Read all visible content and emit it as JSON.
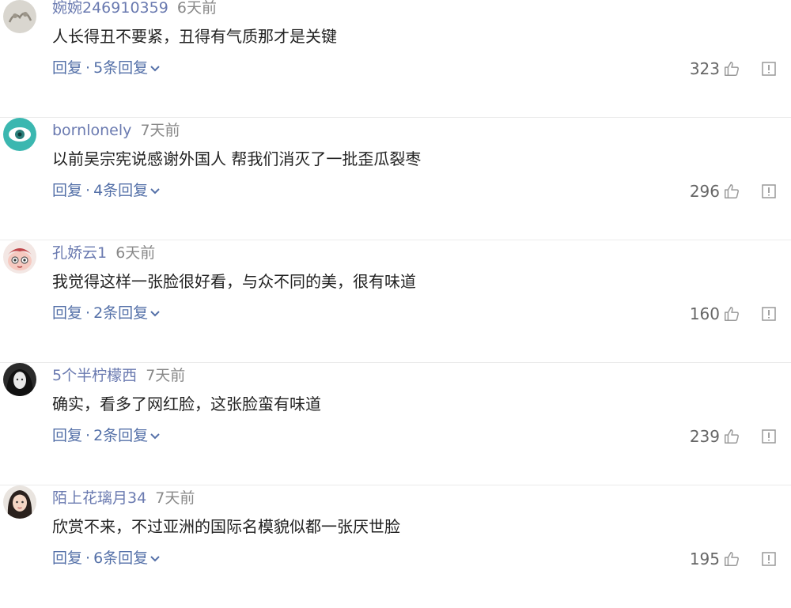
{
  "comments": [
    {
      "username": "婉婉246910359",
      "time": "6天前",
      "text": "人长得丑不要紧，丑得有气质那才是关键",
      "reply_label": "回复",
      "reply_count_label": "5条回复",
      "likes": "323",
      "avatar_icon": "sketch-avatar"
    },
    {
      "username": "bornlonely",
      "time": "7天前",
      "text": "以前吴宗宪说感谢外国人 帮我们消灭了一批歪瓜裂枣",
      "reply_label": "回复",
      "reply_count_label": "4条回复",
      "likes": "296",
      "avatar_icon": "teal-eye-avatar"
    },
    {
      "username": "孔娇云1",
      "time": "6天前",
      "text": "我觉得这样一张脸很好看，与众不同的美，很有味道",
      "reply_label": "回复",
      "reply_count_label": "2条回复",
      "likes": "160",
      "avatar_icon": "cartoon-avatar"
    },
    {
      "username": "5个半柠檬西",
      "time": "7天前",
      "text": "确实，看多了网红脸，这张脸蛮有味道",
      "reply_label": "回复",
      "reply_count_label": "2条回复",
      "likes": "239",
      "avatar_icon": "bw-portrait-avatar"
    },
    {
      "username": "陌上花璃月34",
      "time": "7天前",
      "text": "欣赏不来，不过亚洲的国际名模貌似都一张厌世脸",
      "reply_label": "回复",
      "reply_count_label": "6条回复",
      "likes": "195",
      "avatar_icon": "girl-portrait-avatar"
    }
  ],
  "colors": {
    "username": "#6a7ab0",
    "link": "#5470a8",
    "text": "#222222",
    "muted": "#888888",
    "divider": "#ebebeb"
  }
}
